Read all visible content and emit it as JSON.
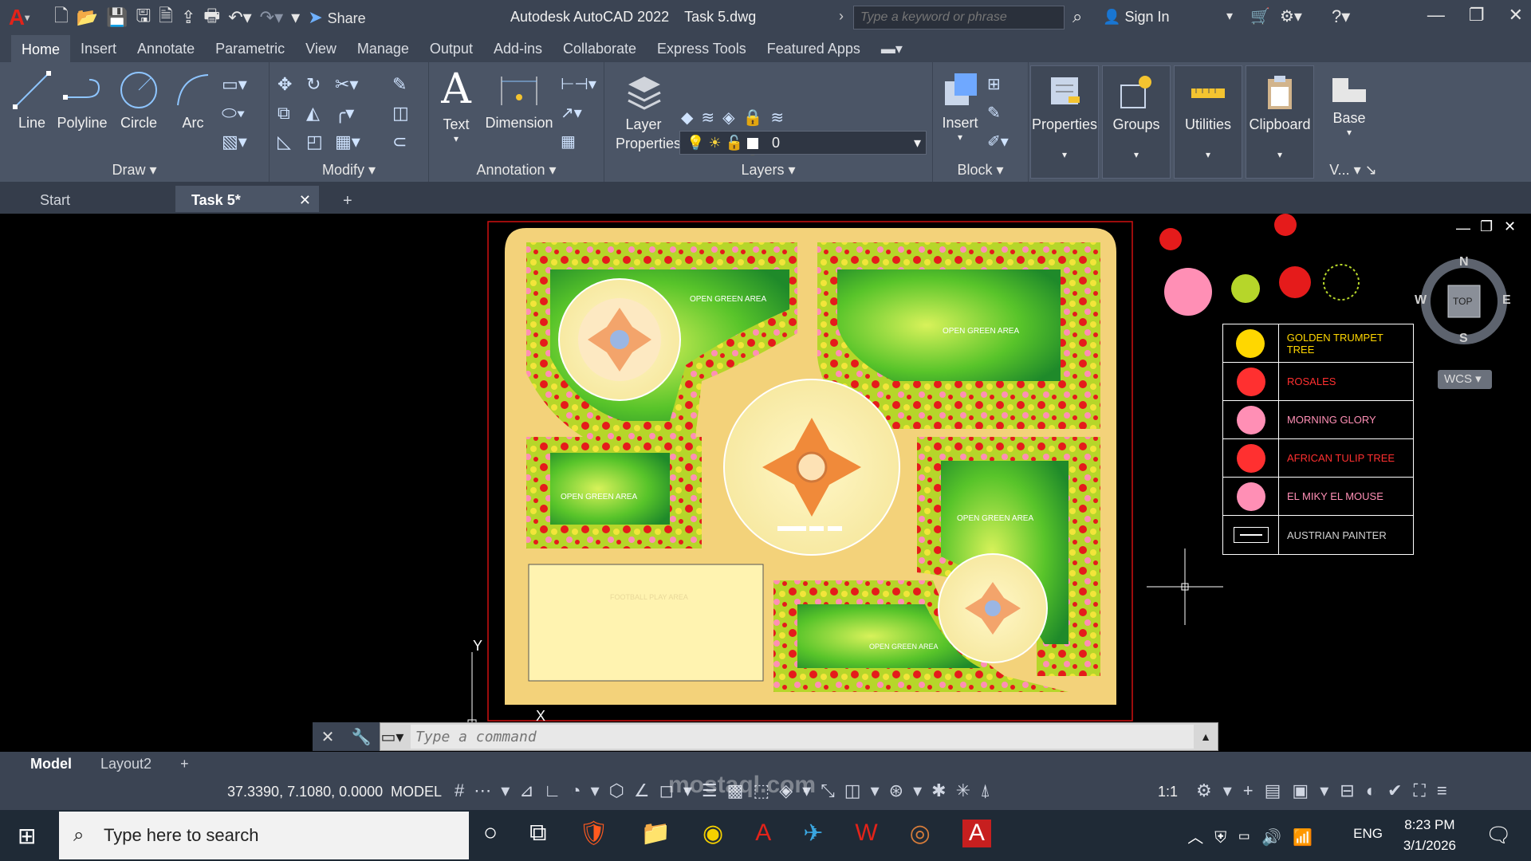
{
  "app": {
    "title": "Autodesk AutoCAD 2022",
    "file": "Task 5.dwg",
    "share_label": "Share",
    "search_placeholder": "Type a keyword or phrase",
    "signin_label": "Sign In"
  },
  "ribbon_tabs": [
    "Home",
    "Insert",
    "Annotate",
    "Parametric",
    "View",
    "Manage",
    "Output",
    "Add-ins",
    "Collaborate",
    "Express Tools",
    "Featured Apps"
  ],
  "ribbon": {
    "draw_tools": [
      "Line",
      "Polyline",
      "Circle",
      "Arc"
    ],
    "panels": {
      "draw": "Draw",
      "modify": "Modify",
      "annotation": "Annotation",
      "layers": "Layers",
      "block": "Block",
      "view": "V..."
    },
    "text_tool": "Text",
    "dimension_tool": "Dimension",
    "layer_properties": "Layer Properties",
    "layer_current": "0",
    "insert_tool": "Insert",
    "big_buttons": [
      "Properties",
      "Groups",
      "Utilities",
      "Clipboard"
    ],
    "base_tool": "Base"
  },
  "doc_tabs": {
    "start": "Start",
    "active": "Task 5*"
  },
  "drawing": {
    "labels": {
      "green1": "OPEN GREEN AREA",
      "green2": "OPEN GREEN AREA",
      "green3": "OPEN GREEN AREA",
      "green4": "OPEN GREEN AREA",
      "green5": "OPEN GREEN AREA",
      "football": "FOOTBALL PLAY AREA"
    }
  },
  "legend": [
    {
      "label": "GOLDEN TRUMPET TREE",
      "color": "#ffd700",
      "icon": "golden-trumpet-tree-icon"
    },
    {
      "label": "ROSALES",
      "color": "#ff3030",
      "icon": "rosales-icon"
    },
    {
      "label": "MORNING GLORY",
      "color": "#ff8fb5",
      "icon": "morning-glory-icon"
    },
    {
      "label": "AFRICAN TULIP TREE",
      "color": "#ff3030",
      "icon": "african-tulip-tree-icon"
    },
    {
      "label": "EL MIKY EL MOUSE",
      "color": "#ff8fb5",
      "icon": "mouse-shape-icon"
    },
    {
      "label": "AUSTRIAN PAINTER",
      "color": "#d0d0d0",
      "icon": "line-symbol-icon"
    }
  ],
  "viewcube": {
    "n": "N",
    "s": "S",
    "e": "E",
    "w": "W",
    "face": "TOP",
    "wcs": "WCS"
  },
  "command": {
    "placeholder": "Type a command"
  },
  "layout_tabs": [
    "Model",
    "Layout2"
  ],
  "status": {
    "coords": "37.3390, 7.1080, 0.0000",
    "model": "MODEL",
    "scale": "1:1"
  },
  "taskbar": {
    "search_placeholder": "Type here to search",
    "lang": "ENG",
    "time": "8:23 PM",
    "date": "3/1/2026"
  },
  "watermark": "mostaql.com"
}
